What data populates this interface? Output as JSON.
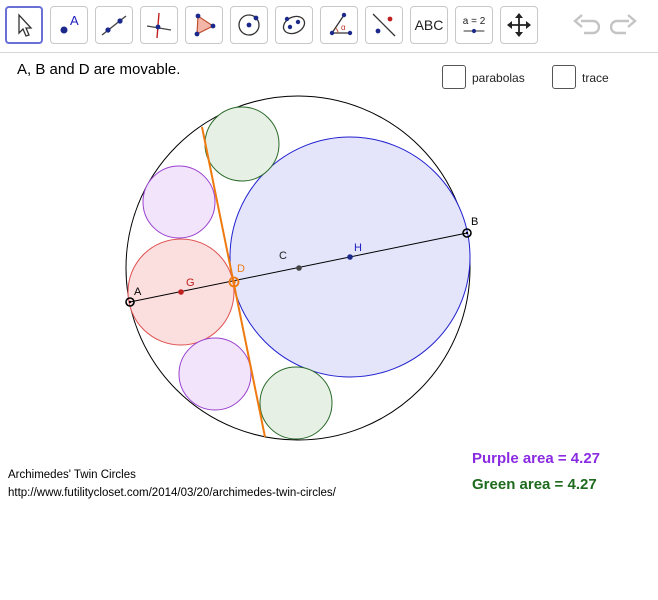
{
  "toolbar": {
    "tools": [
      {
        "name": "move-tool",
        "icon": "cursor-arrow-icon",
        "active": true
      },
      {
        "name": "point-tool",
        "icon": "point-icon",
        "label": "A"
      },
      {
        "name": "line-tool",
        "icon": "line-through-two-points-icon"
      },
      {
        "name": "perpendicular-line-tool",
        "icon": "perpendicular-line-icon"
      },
      {
        "name": "polygon-tool",
        "icon": "polygon-icon"
      },
      {
        "name": "circle-tool",
        "icon": "circle-center-point-icon"
      },
      {
        "name": "conic-tool",
        "icon": "ellipse-icon"
      },
      {
        "name": "angle-tool",
        "icon": "angle-icon"
      },
      {
        "name": "reflect-tool",
        "icon": "reflect-about-line-icon"
      },
      {
        "name": "text-tool",
        "icon": "text-icon",
        "label": "ABC"
      },
      {
        "name": "slider-tool",
        "icon": "slider-icon",
        "label": "a = 2"
      },
      {
        "name": "move-graphics-tool",
        "icon": "move-arrows-icon"
      }
    ],
    "undo_icon": "undo-icon",
    "redo_icon": "redo-icon"
  },
  "info_text": "A, B and D are movable.",
  "checkboxes": [
    {
      "label": "parabolas",
      "checked": false
    },
    {
      "label": "trace",
      "checked": false
    }
  ],
  "points": {
    "A": "A",
    "B": "B",
    "C": "C",
    "D": "D",
    "G": "G",
    "H": "H"
  },
  "results": {
    "purple": "Purple area = 4.27",
    "green": "Green area = 4.27",
    "purple_color": "#8a2be2",
    "green_color": "#1e6b1e"
  },
  "credit": {
    "title": "Archimedes' Twin Circles",
    "url": "http://www.futilitycloset.com/2014/03/20/archimedes-twin-circles/"
  },
  "colors": {
    "active_tool_border": "#6a6fd6",
    "red_circle": "#e05050",
    "red_fill": "#fbdede",
    "blue_circle": "#2020d0",
    "blue_fill": "#e4e4fa",
    "purple_circle": "#9a40d0",
    "purple_fill": "#f1e4fb",
    "green_circle": "#2a6a2a",
    "green_fill": "#e6f0e4",
    "tangent_line": "#ee7a10"
  }
}
